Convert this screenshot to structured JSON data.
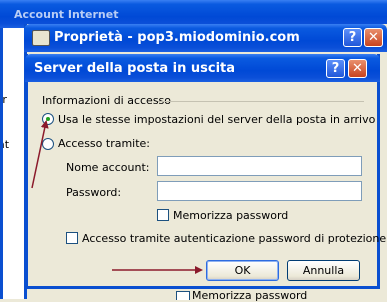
{
  "background_window": {
    "title": "Account Internet",
    "side_text": "rr\ni\ni\nat",
    "bottom_checkbox_label": "Memorizza password"
  },
  "properties_window": {
    "title": "Proprietà - pop3.miodominio.com"
  },
  "dialog": {
    "title": "Server della posta in uscita",
    "group_label": "Informazioni di accesso",
    "radio_same_label": "Usa le stesse impostazioni del server della posta in arrivo",
    "radio_same_selected": true,
    "radio_login_label": "Accesso tramite:",
    "account_label": "Nome account:",
    "account_value": "",
    "password_label": "Password:",
    "password_value": "",
    "remember_label": "Memorizza password",
    "remember_checked": false,
    "spa_label": "Accesso tramite autenticazione password di protezione",
    "spa_checked": false,
    "ok_label": "OK",
    "cancel_label": "Annulla"
  },
  "colors": {
    "annotation_arrow": "#8b1a2b",
    "title_bar": "#0049d6",
    "dialog_bg": "#ece9d8"
  },
  "icons": {
    "help": "?",
    "close": "✕"
  }
}
